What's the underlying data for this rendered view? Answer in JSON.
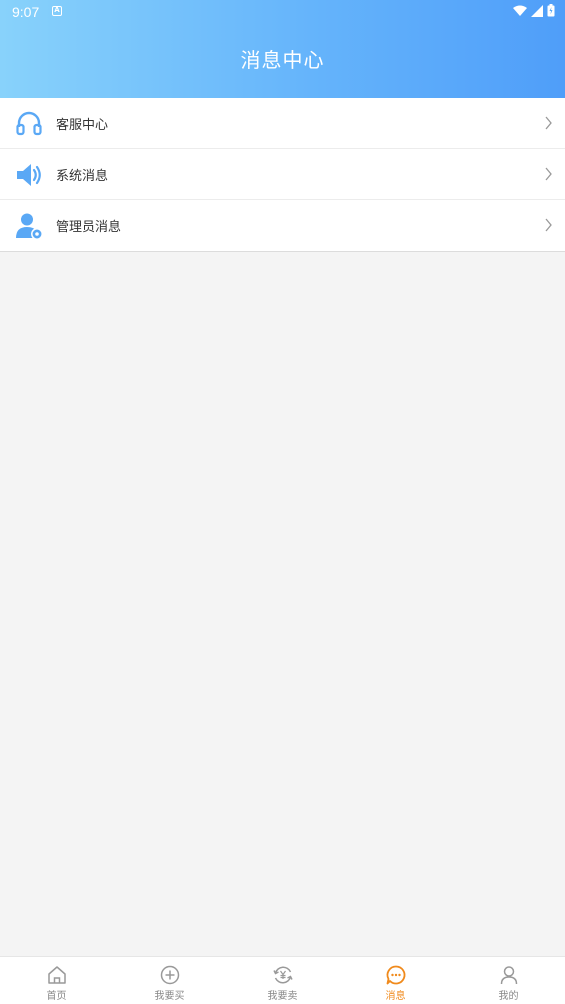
{
  "status_bar": {
    "time": "9:07",
    "notification_letter": "A"
  },
  "header": {
    "title": "消息中心"
  },
  "menu": {
    "items": [
      {
        "label": "客服中心",
        "icon": "headset-icon"
      },
      {
        "label": "系统消息",
        "icon": "speaker-icon"
      },
      {
        "label": "管理员消息",
        "icon": "admin-user-icon"
      }
    ]
  },
  "tabbar": {
    "active_color": "#f08a1c",
    "inactive_color": "#888888",
    "items": [
      {
        "label": "首页",
        "icon": "home-icon"
      },
      {
        "label": "我要买",
        "icon": "plus-circle-icon"
      },
      {
        "label": "我要卖",
        "icon": "yen-cycle-icon"
      },
      {
        "label": "消息",
        "icon": "chat-bubble-icon",
        "active": true
      },
      {
        "label": "我的",
        "icon": "person-icon"
      }
    ]
  },
  "colors": {
    "accent": "#4f9ef9",
    "icon_blue": "#5aa8f5"
  }
}
